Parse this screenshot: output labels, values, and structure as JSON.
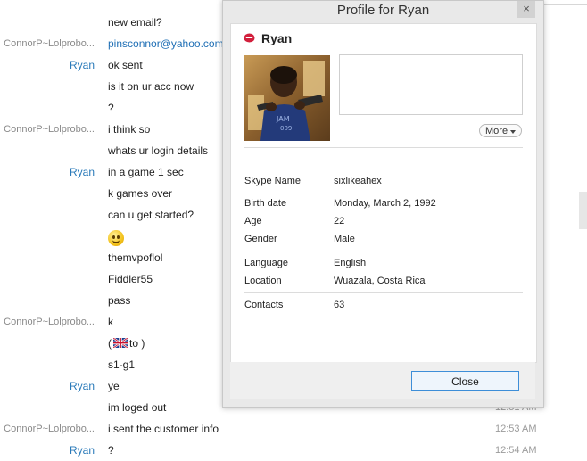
{
  "chat": {
    "rows": [
      {
        "sender": "",
        "text": "",
        "time": "",
        "kind": "text"
      },
      {
        "sender": "",
        "text": "new email?",
        "time": "",
        "kind": "text"
      },
      {
        "sender": "ConnorP~Lolprobo...",
        "text": "pinsconnor@yahoo.com",
        "time": "",
        "kind": "link"
      },
      {
        "sender": "Ryan",
        "text": "ok sent",
        "time": "",
        "kind": "text"
      },
      {
        "sender": "",
        "text": "is it on ur acc now",
        "time": "",
        "kind": "text"
      },
      {
        "sender": "",
        "text": "?",
        "time": "",
        "kind": "text"
      },
      {
        "sender": "ConnorP~Lolprobo...",
        "text": "i think so",
        "time": "",
        "kind": "text"
      },
      {
        "sender": "",
        "text": "whats ur login details",
        "time": "",
        "kind": "text"
      },
      {
        "sender": "Ryan",
        "text": "in a game 1 sec",
        "time": "",
        "kind": "text"
      },
      {
        "sender": "",
        "text": "k games over",
        "time": "",
        "kind": "text"
      },
      {
        "sender": "",
        "text": "can u get started?",
        "time": "",
        "kind": "text"
      },
      {
        "sender": "",
        "text": "",
        "time": "",
        "kind": "emoji"
      },
      {
        "sender": "",
        "text": "themvpoflol",
        "time": "",
        "kind": "text"
      },
      {
        "sender": "",
        "text": "Fiddler55",
        "time": "",
        "kind": "text"
      },
      {
        "sender": "",
        "text": "pass",
        "time": "",
        "kind": "text"
      },
      {
        "sender": "ConnorP~Lolprobo...",
        "text": "k",
        "time": "",
        "kind": "text"
      },
      {
        "sender": "",
        "text_before": "(",
        "text_after": "to )",
        "time": "",
        "kind": "flag"
      },
      {
        "sender": "",
        "text": "s1-g1",
        "time": "",
        "kind": "text"
      },
      {
        "sender": "Ryan",
        "text": "ye",
        "time": "",
        "kind": "text"
      },
      {
        "sender": "",
        "text": "im loged out",
        "time": "12:51 AM",
        "kind": "text"
      },
      {
        "sender": "ConnorP~Lolprobo...",
        "text": "i sent the customer info",
        "time": "12:53 AM",
        "kind": "text"
      },
      {
        "sender": "Ryan",
        "text": "?",
        "time": "12:54 AM",
        "kind": "text"
      }
    ]
  },
  "dialog": {
    "title": "Profile for Ryan",
    "close_x": "×",
    "profile_name": "Ryan",
    "more_label": "More",
    "close_label": "Close",
    "fields": [
      {
        "label": "Skype Name",
        "value": "sixlikeahex"
      },
      {
        "label": "Birth date",
        "value": "Monday, March 2, 1992"
      },
      {
        "label": "Age",
        "value": "22"
      },
      {
        "label": "Gender",
        "value": "Male"
      },
      {
        "label": "Language",
        "value": "English"
      },
      {
        "label": "Location",
        "value": "Wuazala, Costa Rica"
      },
      {
        "label": "Contacts",
        "value": "63"
      }
    ]
  },
  "colors": {
    "accent": "#2a7ab9",
    "link": "#1f6fb5",
    "status": "#d21f3c",
    "button_border": "#3d8ed8"
  },
  "icons": {
    "status": "skype-status-icon",
    "emoji": "smile-emoji-icon",
    "flag": "uk-flag-icon",
    "more": "chevron-down-icon"
  }
}
